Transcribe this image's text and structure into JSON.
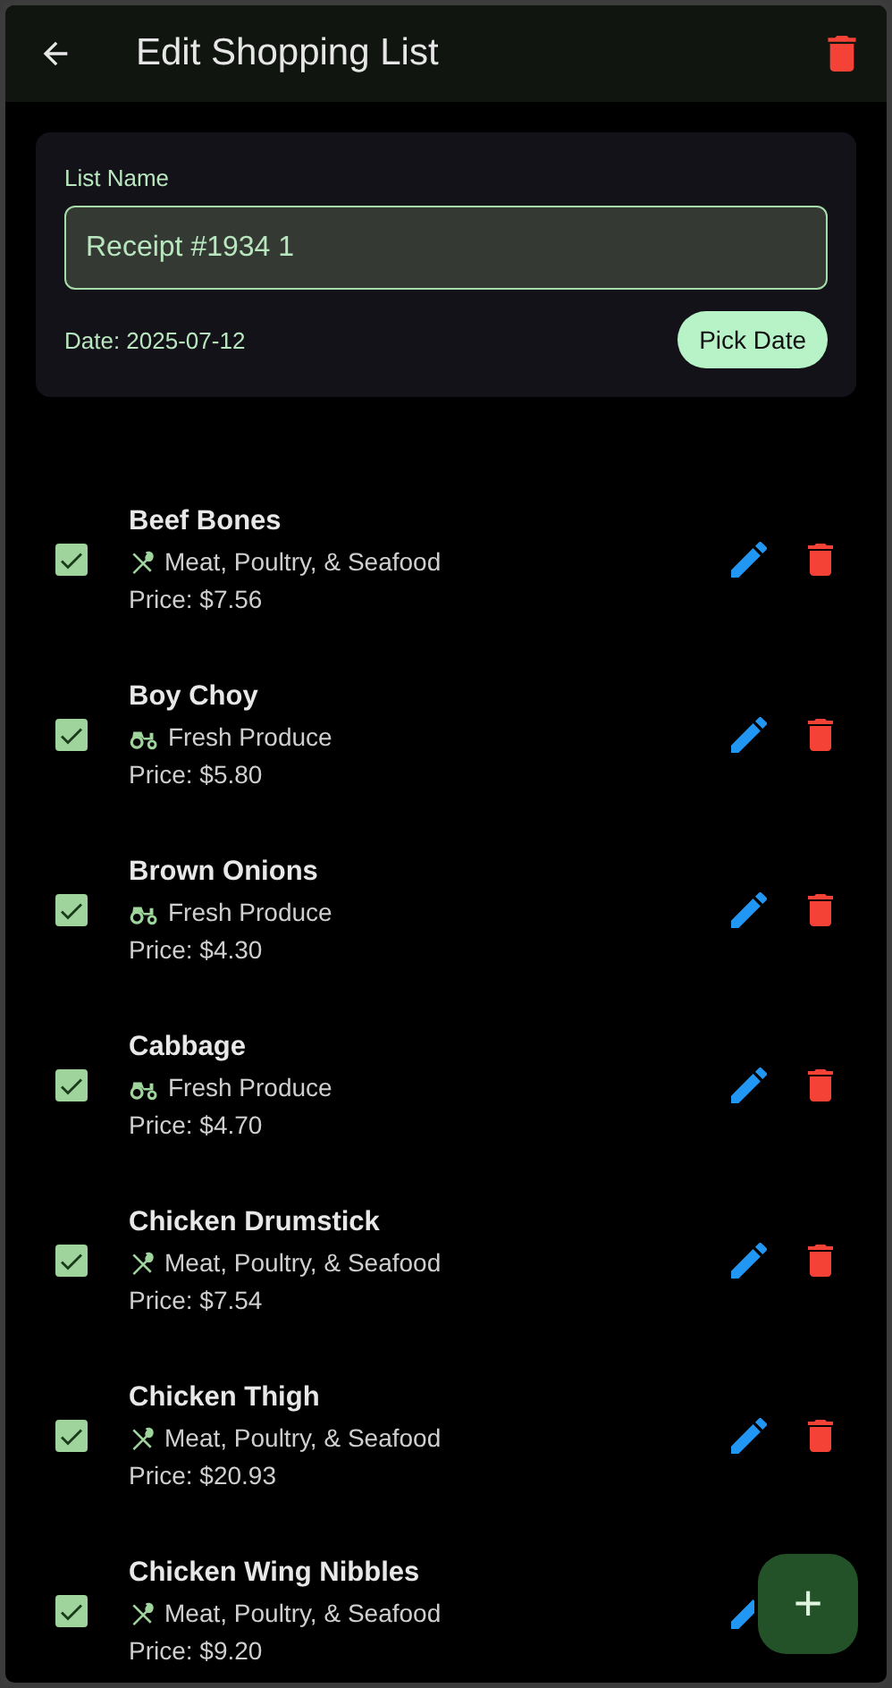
{
  "app_bar": {
    "title": "Edit Shopping List"
  },
  "form": {
    "label": "List Name",
    "value": "Receipt #1934 1",
    "date": "Date: 2025-07-12",
    "pick_button": "Pick Date"
  },
  "items": [
    {
      "name": "Beef Bones",
      "category": "Meat, Poultry, & Seafood",
      "kind": "meat",
      "price": "Price: $7.56",
      "checked": true
    },
    {
      "name": "Boy Choy",
      "category": "Fresh Produce",
      "kind": "produce",
      "price": "Price: $5.80",
      "checked": true
    },
    {
      "name": "Brown Onions",
      "category": "Fresh Produce",
      "kind": "produce",
      "price": "Price: $4.30",
      "checked": true
    },
    {
      "name": "Cabbage",
      "category": "Fresh Produce",
      "kind": "produce",
      "price": "Price: $4.70",
      "checked": true
    },
    {
      "name": "Chicken Drumstick",
      "category": "Meat, Poultry, & Seafood",
      "kind": "meat",
      "price": "Price: $7.54",
      "checked": true
    },
    {
      "name": "Chicken Thigh",
      "category": "Meat, Poultry, & Seafood",
      "kind": "meat",
      "price": "Price: $20.93",
      "checked": true
    },
    {
      "name": "Chicken Wing Nibbles",
      "category": "Meat, Poultry, & Seafood",
      "kind": "meat",
      "price": "Price: $9.20",
      "checked": true
    }
  ],
  "fab": {
    "label": "+"
  }
}
